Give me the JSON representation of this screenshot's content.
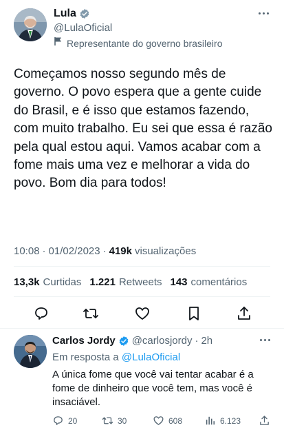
{
  "tweet": {
    "author": {
      "display_name": "Lula",
      "handle": "@LulaOficial",
      "affiliation": "Representante do governo brasileiro",
      "avatar_icon": "lula-avatar",
      "verified_icon": "verified-badge-icon"
    },
    "text": "Começamos nosso segundo mês de governo. O povo espera que a gente cuide do Brasil, e é isso que estamos fazendo, com muito trabalho. Eu sei que essa é razão pela qual estou aqui. Vamos acabar com a fome mais uma vez e melhorar a vida do povo. Bom dia para todos!",
    "time": "10:08",
    "date": "01/02/2023",
    "views_count": "419k",
    "views_label": "visualizações",
    "stats": {
      "likes_count": "13,3k",
      "likes_label": "Curtidas",
      "retweets_count": "1.221",
      "retweets_label": "Retweets",
      "comments_count": "143",
      "comments_label": "comentários"
    },
    "actions": [
      "reply-icon",
      "retweet-icon",
      "like-icon",
      "bookmark-icon",
      "share-icon"
    ]
  },
  "reply": {
    "display_name": "Carlos Jordy",
    "handle": "@carlosjordy",
    "time_ago": "2h",
    "in_reply_prefix": "Em resposta a",
    "in_reply_mention": "@LulaOficial",
    "text": "A única fome que você vai tentar acabar é a fome de dinheiro que você tem, mas você é insaciável.",
    "counts": {
      "replies": "20",
      "retweets": "30",
      "likes": "608",
      "views": "6.123"
    }
  },
  "colors": {
    "text_primary": "#0f1419",
    "text_secondary": "#536471",
    "accent": "#1d9bf0",
    "divider": "#eff3f4"
  }
}
